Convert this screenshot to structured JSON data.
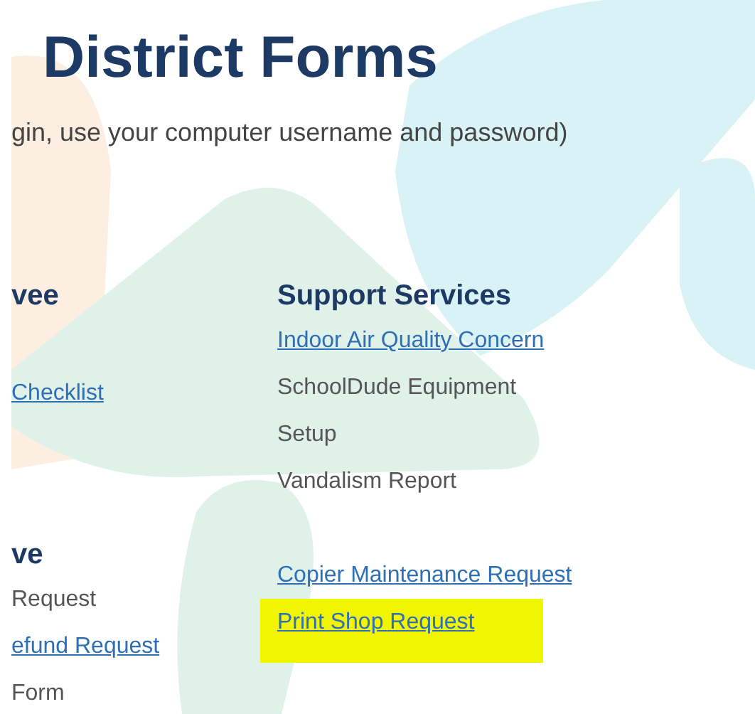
{
  "title": "District Forms",
  "subtitle": "gin, use your computer username and password)",
  "columns": [
    {
      "sections": [
        {
          "heading": "vee",
          "items": [
            {
              "text": "Checklist",
              "kind": "link",
              "highlighted": false
            }
          ]
        },
        {
          "heading": "ve",
          "items": [
            {
              "text": "Request",
              "kind": "text",
              "highlighted": false
            },
            {
              "text": "efund Request",
              "kind": "link",
              "highlighted": false
            },
            {
              "text": "Form",
              "kind": "text",
              "highlighted": false
            }
          ]
        }
      ]
    },
    {
      "sections": [
        {
          "heading": "Support Services",
          "items": [
            {
              "text": "Indoor Air Quality Concern",
              "kind": "link",
              "highlighted": false
            },
            {
              "text": "SchoolDude Equipment Setup",
              "kind": "text",
              "highlighted": false
            },
            {
              "text": "Vandalism Report",
              "kind": "text",
              "highlighted": false
            }
          ]
        },
        {
          "items": [
            {
              "text": "Copier Maintenance Request",
              "kind": "link",
              "highlighted": false
            },
            {
              "text": "Print Shop Request",
              "kind": "link",
              "highlighted": true
            }
          ]
        }
      ]
    }
  ]
}
